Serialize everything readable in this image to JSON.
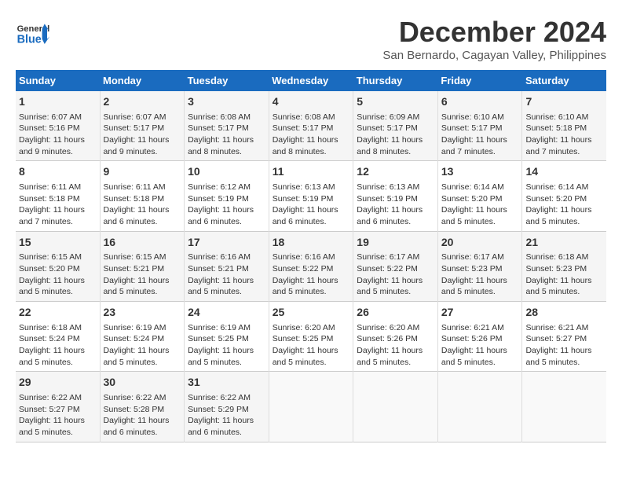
{
  "header": {
    "logo_line1": "General",
    "logo_line2": "Blue",
    "month": "December 2024",
    "location": "San Bernardo, Cagayan Valley, Philippines"
  },
  "weekdays": [
    "Sunday",
    "Monday",
    "Tuesday",
    "Wednesday",
    "Thursday",
    "Friday",
    "Saturday"
  ],
  "weeks": [
    [
      {
        "day": "1",
        "info": "Sunrise: 6:07 AM\nSunset: 5:16 PM\nDaylight: 11 hours\nand 9 minutes."
      },
      {
        "day": "2",
        "info": "Sunrise: 6:07 AM\nSunset: 5:17 PM\nDaylight: 11 hours\nand 9 minutes."
      },
      {
        "day": "3",
        "info": "Sunrise: 6:08 AM\nSunset: 5:17 PM\nDaylight: 11 hours\nand 8 minutes."
      },
      {
        "day": "4",
        "info": "Sunrise: 6:08 AM\nSunset: 5:17 PM\nDaylight: 11 hours\nand 8 minutes."
      },
      {
        "day": "5",
        "info": "Sunrise: 6:09 AM\nSunset: 5:17 PM\nDaylight: 11 hours\nand 8 minutes."
      },
      {
        "day": "6",
        "info": "Sunrise: 6:10 AM\nSunset: 5:17 PM\nDaylight: 11 hours\nand 7 minutes."
      },
      {
        "day": "7",
        "info": "Sunrise: 6:10 AM\nSunset: 5:18 PM\nDaylight: 11 hours\nand 7 minutes."
      }
    ],
    [
      {
        "day": "8",
        "info": "Sunrise: 6:11 AM\nSunset: 5:18 PM\nDaylight: 11 hours\nand 7 minutes."
      },
      {
        "day": "9",
        "info": "Sunrise: 6:11 AM\nSunset: 5:18 PM\nDaylight: 11 hours\nand 6 minutes."
      },
      {
        "day": "10",
        "info": "Sunrise: 6:12 AM\nSunset: 5:19 PM\nDaylight: 11 hours\nand 6 minutes."
      },
      {
        "day": "11",
        "info": "Sunrise: 6:13 AM\nSunset: 5:19 PM\nDaylight: 11 hours\nand 6 minutes."
      },
      {
        "day": "12",
        "info": "Sunrise: 6:13 AM\nSunset: 5:19 PM\nDaylight: 11 hours\nand 6 minutes."
      },
      {
        "day": "13",
        "info": "Sunrise: 6:14 AM\nSunset: 5:20 PM\nDaylight: 11 hours\nand 5 minutes."
      },
      {
        "day": "14",
        "info": "Sunrise: 6:14 AM\nSunset: 5:20 PM\nDaylight: 11 hours\nand 5 minutes."
      }
    ],
    [
      {
        "day": "15",
        "info": "Sunrise: 6:15 AM\nSunset: 5:20 PM\nDaylight: 11 hours\nand 5 minutes."
      },
      {
        "day": "16",
        "info": "Sunrise: 6:15 AM\nSunset: 5:21 PM\nDaylight: 11 hours\nand 5 minutes."
      },
      {
        "day": "17",
        "info": "Sunrise: 6:16 AM\nSunset: 5:21 PM\nDaylight: 11 hours\nand 5 minutes."
      },
      {
        "day": "18",
        "info": "Sunrise: 6:16 AM\nSunset: 5:22 PM\nDaylight: 11 hours\nand 5 minutes."
      },
      {
        "day": "19",
        "info": "Sunrise: 6:17 AM\nSunset: 5:22 PM\nDaylight: 11 hours\nand 5 minutes."
      },
      {
        "day": "20",
        "info": "Sunrise: 6:17 AM\nSunset: 5:23 PM\nDaylight: 11 hours\nand 5 minutes."
      },
      {
        "day": "21",
        "info": "Sunrise: 6:18 AM\nSunset: 5:23 PM\nDaylight: 11 hours\nand 5 minutes."
      }
    ],
    [
      {
        "day": "22",
        "info": "Sunrise: 6:18 AM\nSunset: 5:24 PM\nDaylight: 11 hours\nand 5 minutes."
      },
      {
        "day": "23",
        "info": "Sunrise: 6:19 AM\nSunset: 5:24 PM\nDaylight: 11 hours\nand 5 minutes."
      },
      {
        "day": "24",
        "info": "Sunrise: 6:19 AM\nSunset: 5:25 PM\nDaylight: 11 hours\nand 5 minutes."
      },
      {
        "day": "25",
        "info": "Sunrise: 6:20 AM\nSunset: 5:25 PM\nDaylight: 11 hours\nand 5 minutes."
      },
      {
        "day": "26",
        "info": "Sunrise: 6:20 AM\nSunset: 5:26 PM\nDaylight: 11 hours\nand 5 minutes."
      },
      {
        "day": "27",
        "info": "Sunrise: 6:21 AM\nSunset: 5:26 PM\nDaylight: 11 hours\nand 5 minutes."
      },
      {
        "day": "28",
        "info": "Sunrise: 6:21 AM\nSunset: 5:27 PM\nDaylight: 11 hours\nand 5 minutes."
      }
    ],
    [
      {
        "day": "29",
        "info": "Sunrise: 6:22 AM\nSunset: 5:27 PM\nDaylight: 11 hours\nand 5 minutes."
      },
      {
        "day": "30",
        "info": "Sunrise: 6:22 AM\nSunset: 5:28 PM\nDaylight: 11 hours\nand 6 minutes."
      },
      {
        "day": "31",
        "info": "Sunrise: 6:22 AM\nSunset: 5:29 PM\nDaylight: 11 hours\nand 6 minutes."
      },
      null,
      null,
      null,
      null
    ]
  ]
}
